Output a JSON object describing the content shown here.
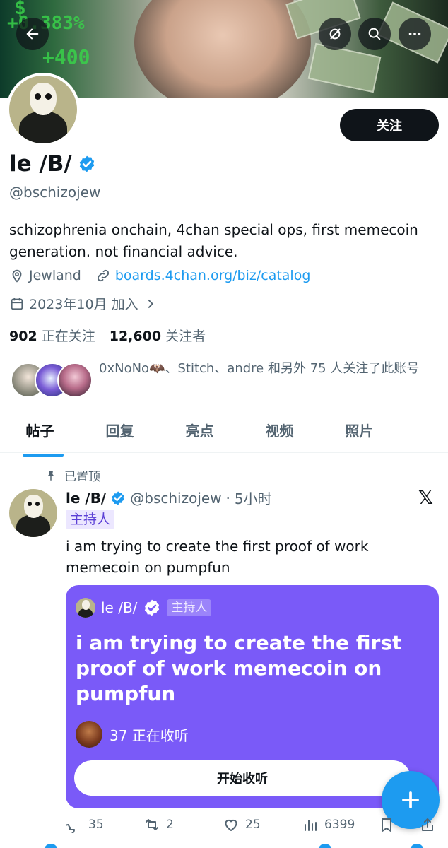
{
  "header": {
    "back_icon": "back-arrow-icon",
    "grok_icon": "grok-icon",
    "search_icon": "search-icon",
    "more_icon": "more-icon"
  },
  "banner": {
    "ticker_1": "+0.383%",
    "ticker_2": "+400"
  },
  "profile": {
    "name": "le /B/",
    "handle": "@bschizojew",
    "follow_label": "关注",
    "bio": "schizophrenia onchain, 4chan special ops, first memecoin generation. not financial advice.",
    "location": "Jewland",
    "website": "boards.4chan.org/biz/catalog",
    "joined": "2023年10月 加入",
    "following_count": "902",
    "following_label": "正在关注",
    "followers_count": "12,600",
    "followers_label": "关注者",
    "followed_by": "0xNoNo🦇、Stitch、andre 和另外 75 人关注了此账号"
  },
  "tabs": [
    {
      "label": "帖子",
      "active": true
    },
    {
      "label": "回复"
    },
    {
      "label": "亮点"
    },
    {
      "label": "视频"
    },
    {
      "label": "照片"
    }
  ],
  "post": {
    "pinned_label": "已置顶",
    "author_name": "le /B/",
    "author_handle": "@bschizojew",
    "separator": "·",
    "time": "5小时",
    "host_label": "主持人",
    "text": "i am trying to create the first proof of work memecoin on pumpfun",
    "space": {
      "host_name": "le /B/",
      "host_label": "主持人",
      "title": "i am trying to create the first proof of work memecoin on pumpfun",
      "listeners": "37 正在收听",
      "listen_label": "开始收听"
    },
    "stats": {
      "replies": "35",
      "reposts": "2",
      "likes": "25",
      "views": "6399"
    }
  },
  "colors": {
    "accent": "#1d9bf0",
    "space_bg": "#7a5af8",
    "text": "#0f1419",
    "muted": "#536471"
  }
}
